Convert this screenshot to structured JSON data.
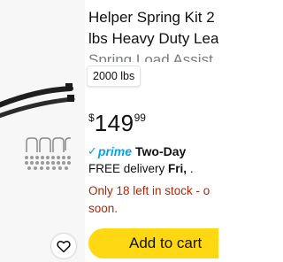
{
  "product": {
    "title_lines": [
      "Helper Spring Kit 2",
      "lbs Heavy Duty Lea",
      "Spring Load Assist"
    ],
    "variant": "2000 lbs",
    "price": {
      "currency": "$",
      "whole": "149",
      "fraction": "99"
    },
    "prime": {
      "label": "prime",
      "speed": "Two-Day"
    },
    "delivery": {
      "prefix": "FREE delivery",
      "date": "Fri,",
      "suffix": "."
    },
    "stock_lines": [
      "Only 18 left in stock - o",
      "soon."
    ]
  },
  "actions": {
    "add_to_cart": "Add to cart"
  },
  "icons": {
    "wishlist": "heart-outline-icon",
    "prime_check": "check-icon"
  },
  "colors": {
    "prime_blue": "#00a8e1",
    "stock_red": "#b12704",
    "cart_yellow": "#ffd814",
    "image_bg": "#f7f7f7"
  }
}
